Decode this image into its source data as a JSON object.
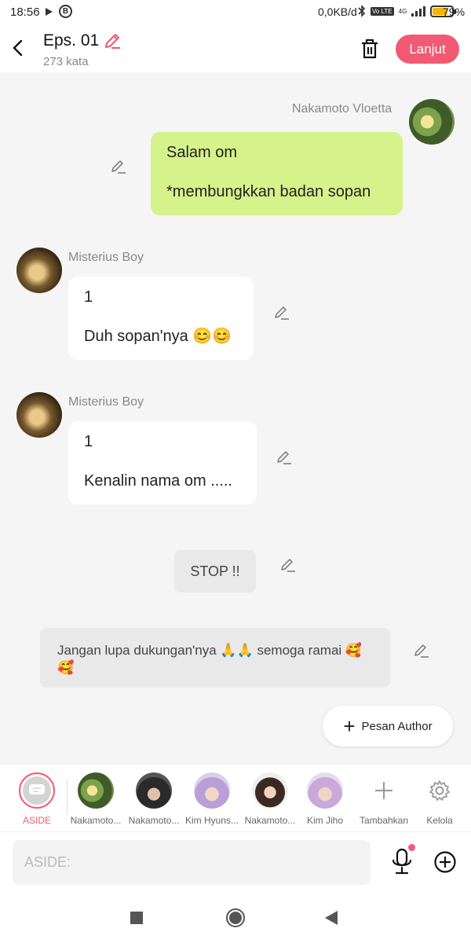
{
  "status_bar": {
    "time": "18:56",
    "network_speed": "0,0KB/d",
    "battery_percent": "79%",
    "battery_level": 0.79,
    "circle_badge": "B",
    "tag_vo": "Vo LTE",
    "tag_4g": "4G"
  },
  "header": {
    "title": "Eps. 01",
    "subtitle": "273 kata",
    "action_label": "Lanjut"
  },
  "messages": [
    {
      "sender": "Nakamoto Vloetta",
      "side": "right",
      "lines": [
        "Salam om",
        "*membungkkan badan sopan"
      ]
    },
    {
      "sender": "Misterius Boy",
      "side": "left",
      "lines": [
        "1",
        "Duh sopan'nya 😊😊"
      ]
    },
    {
      "sender": "Misterius Boy",
      "side": "left",
      "lines": [
        "1",
        "Kenalin nama om ....."
      ]
    }
  ],
  "narration": "STOP !!",
  "aside_note": "Jangan lupa dukungan'nya 🙏🙏 semoga ramai 🥰🥰",
  "pesan_author_label": "Pesan Author",
  "characters": [
    {
      "label": "ASIDE"
    },
    {
      "label": "Nakamoto..."
    },
    {
      "label": "Nakamoto..."
    },
    {
      "label": "Kim Hyuns..."
    },
    {
      "label": "Nakamoto..."
    },
    {
      "label": "Kim Jiho"
    },
    {
      "label": "Tambahkan"
    },
    {
      "label": "Kelola"
    }
  ],
  "input": {
    "placeholder": "ASIDE:"
  },
  "colors": {
    "accent": "#f15a72",
    "bubble_green": "#d6f28a",
    "background": "#f5f5f5"
  }
}
